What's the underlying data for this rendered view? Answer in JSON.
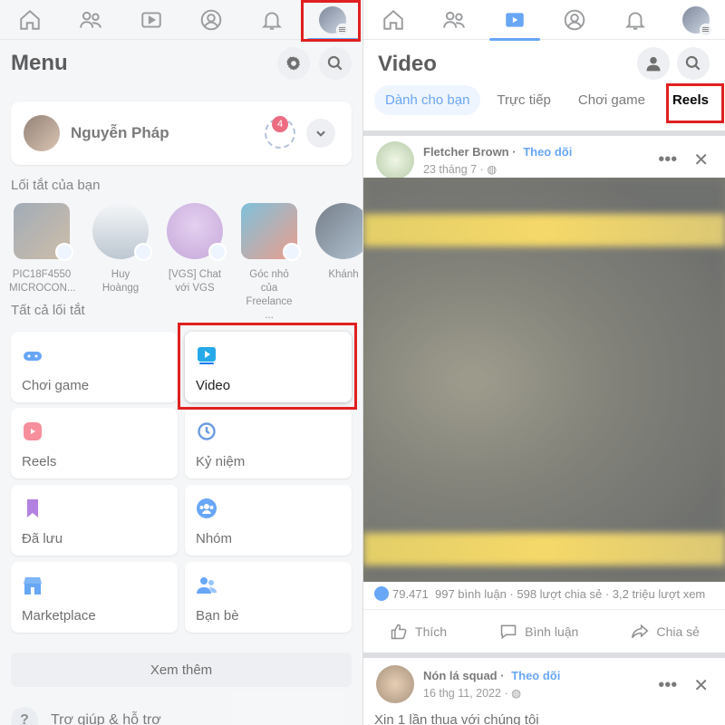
{
  "left": {
    "menu_title": "Menu",
    "profile": {
      "name": "Nguyễn Pháp",
      "story_count": "4"
    },
    "shortcuts_label": "Lối tắt của bạn",
    "shortcuts": [
      {
        "label": "PIC18F4550\nMICROCON..."
      },
      {
        "label": "Huy Hoàngg"
      },
      {
        "label": "[VGS] Chat\nvới VGS"
      },
      {
        "label": "Góc nhỏ của\nFreelance ..."
      },
      {
        "label": "Khánh"
      }
    ],
    "all_shortcuts_label": "Tất cả lối tắt",
    "tiles": [
      {
        "label": "Chơi game",
        "icon": "gamepad-icon"
      },
      {
        "label": "Video",
        "icon": "video-play-icon"
      },
      {
        "label": "Reels",
        "icon": "reels-icon"
      },
      {
        "label": "Kỷ niệm",
        "icon": "memories-clock-icon"
      },
      {
        "label": "Đã lưu",
        "icon": "bookmark-icon"
      },
      {
        "label": "Nhóm",
        "icon": "groups-icon"
      },
      {
        "label": "Marketplace",
        "icon": "shop-icon"
      },
      {
        "label": "Bạn bè",
        "icon": "friends-icon"
      }
    ],
    "see_more": "Xem thêm",
    "help": "Trợ giúp & hỗ trợ"
  },
  "right": {
    "title": "Video",
    "tabs": [
      "Dành cho bạn",
      "Trực tiếp",
      "Chơi game",
      "Reels"
    ],
    "post1": {
      "author": "Fletcher Brown",
      "follow": "Theo dõi",
      "date": "23 tháng 7",
      "likes": "79.471",
      "comments": "997 bình luận",
      "shares": "598 lượt chia sẻ",
      "views": "3,2 triệu lượt xem"
    },
    "actions": {
      "like": "Thích",
      "comment": "Bình luận",
      "share": "Chia sẻ"
    },
    "post2": {
      "author": "Nón lá squad",
      "follow": "Theo dõi",
      "date": "16 thg 11, 2022",
      "text": "Xin 1 lần thua với chúng tôi"
    }
  },
  "colors": {
    "accent": "#1877f2",
    "highlight_box": "#e02020",
    "badge": "#e41e3f"
  }
}
